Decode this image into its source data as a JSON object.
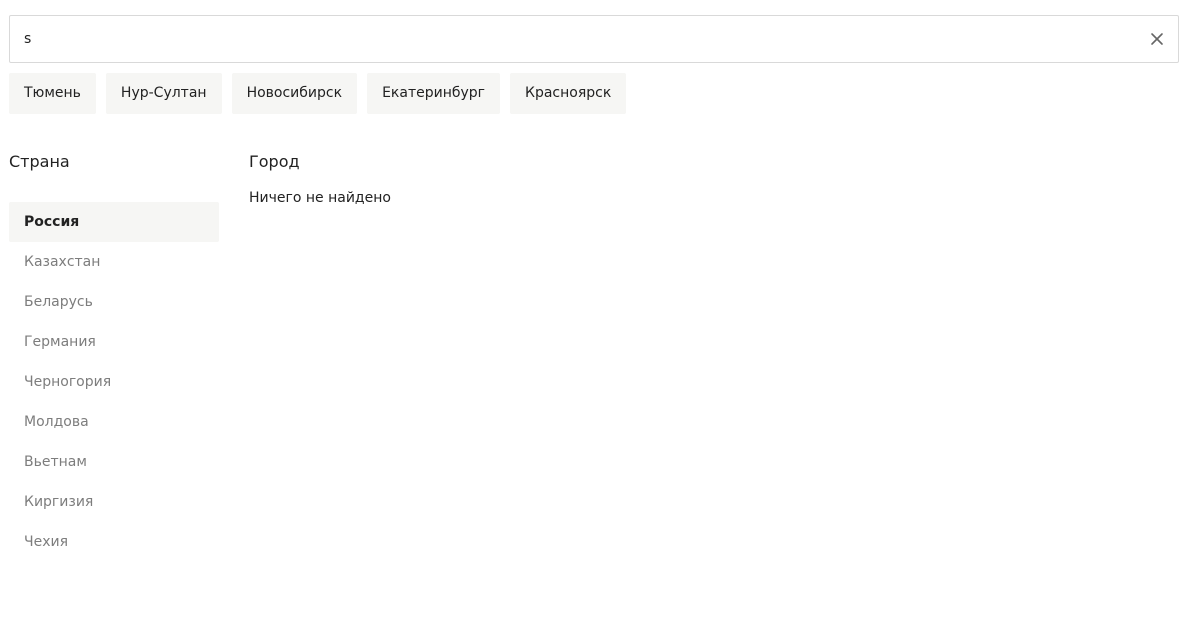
{
  "search": {
    "value": "s",
    "clear_icon": "close-icon"
  },
  "popular_cities": [
    "Тюмень",
    "Нур-Султан",
    "Новосибирск",
    "Екатеринбург",
    "Красноярск"
  ],
  "countries": {
    "title": "Страна",
    "active_index": 0,
    "items": [
      "Россия",
      "Казахстан",
      "Беларусь",
      "Германия",
      "Черногория",
      "Молдова",
      "Вьетнам",
      "Киргизия",
      "Чехия"
    ]
  },
  "cities": {
    "title": "Город",
    "empty_message": "Ничего не найдено"
  },
  "colors": {
    "chip_bg": "#f6f6f4",
    "muted_text": "#7d7d7d",
    "border": "#d9d9d9"
  }
}
